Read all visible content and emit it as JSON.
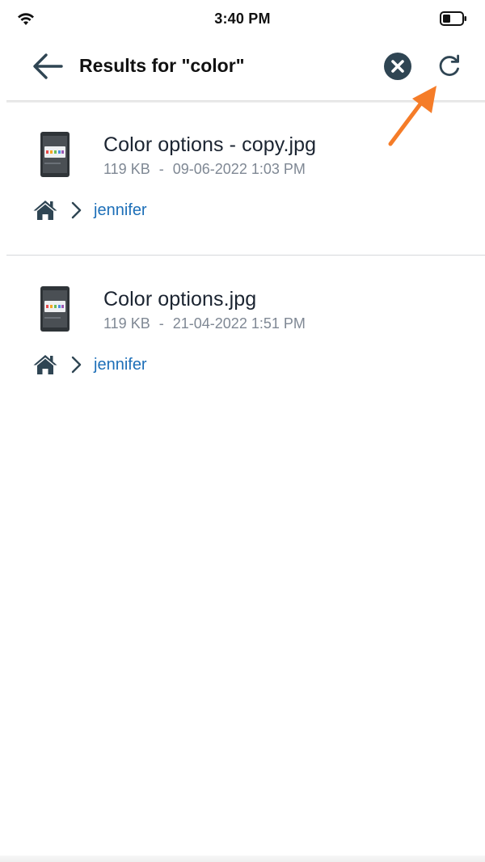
{
  "status_bar": {
    "time": "3:40 PM",
    "wifi_icon": "wifi-icon",
    "battery_icon": "battery-icon"
  },
  "header": {
    "title": "Results for \"color\"",
    "back_icon": "arrow-left-icon",
    "clear_icon": "close-circle-icon",
    "refresh_icon": "refresh-icon"
  },
  "annotation": {
    "color": "#f57c28",
    "points_to": "refresh-button"
  },
  "results": [
    {
      "name": "Color options - copy.jpg",
      "size": "119 KB",
      "separator": "-",
      "date": "09-06-2022 1:03 PM",
      "path_folder": "jennifer"
    },
    {
      "name": "Color options.jpg",
      "size": "119 KB",
      "separator": "-",
      "date": "21-04-2022 1:51 PM",
      "path_folder": "jennifer"
    }
  ],
  "colors": {
    "accent_link": "#1d6fb8",
    "icon_dark": "#2f4553",
    "meta_text": "#7f8894"
  }
}
